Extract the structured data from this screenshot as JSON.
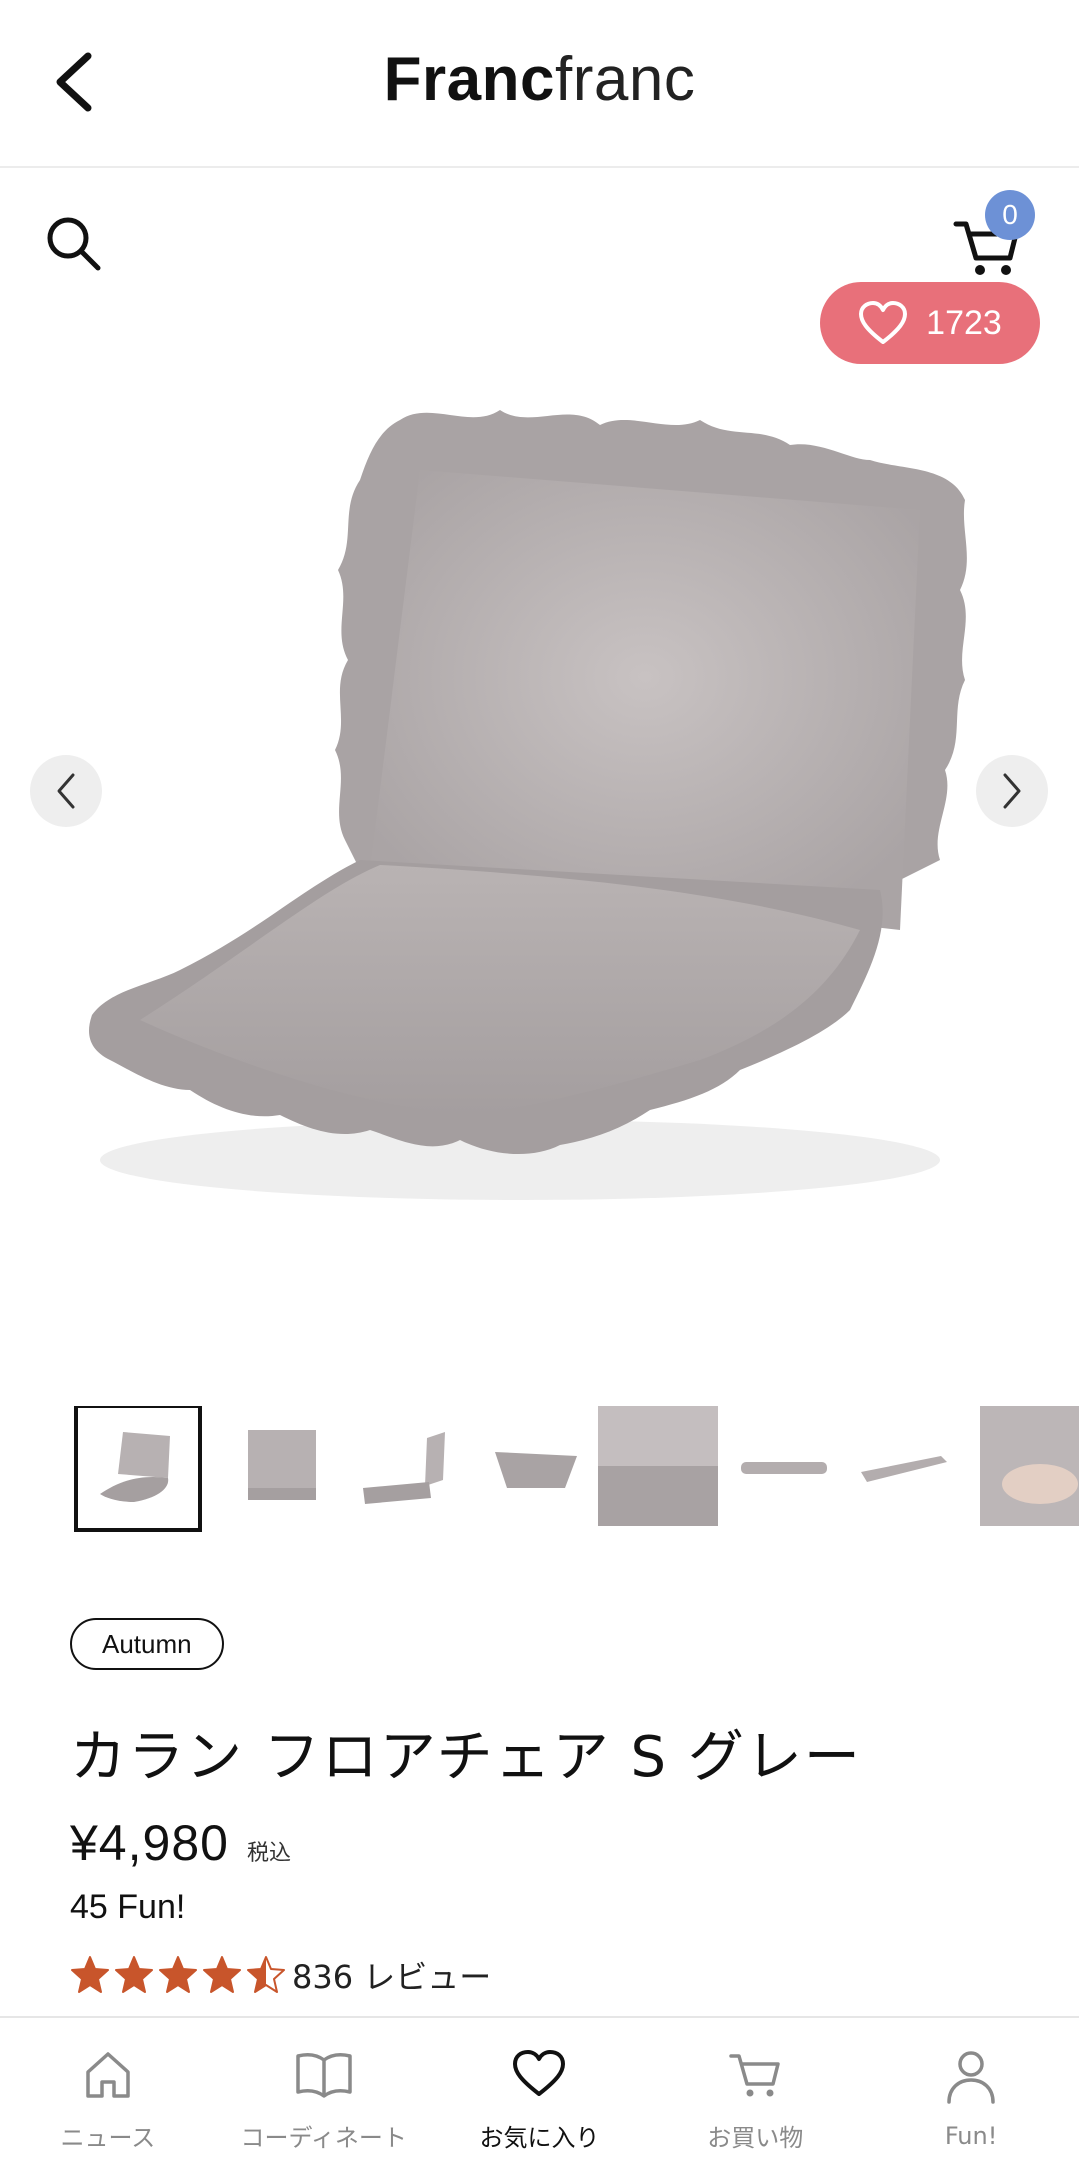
{
  "header": {
    "logo_bold": "Franc",
    "logo_light": "franc"
  },
  "cart": {
    "count": "0"
  },
  "favorite": {
    "count": "1723"
  },
  "product": {
    "tag": "Autumn",
    "title": "カラン フロアチェア S グレー",
    "price": "¥4,980",
    "tax_note": "税込",
    "fun_points": "45 Fun!",
    "rating": 4.5,
    "review_text": "836 レビュー"
  },
  "colors": {
    "accent_pink": "#e8707a",
    "badge_blue": "#6d91d6",
    "star_orange": "#c8552b",
    "chair_gray": "#bdb7b7"
  },
  "bottom_nav": [
    {
      "label": "ニュース",
      "icon": "house-icon"
    },
    {
      "label": "コーディネート",
      "icon": "book-icon"
    },
    {
      "label": "お気に入り",
      "icon": "heart-icon",
      "active": true
    },
    {
      "label": "お買い物",
      "icon": "cart-icon"
    },
    {
      "label": "Fun!",
      "icon": "person-icon"
    }
  ]
}
